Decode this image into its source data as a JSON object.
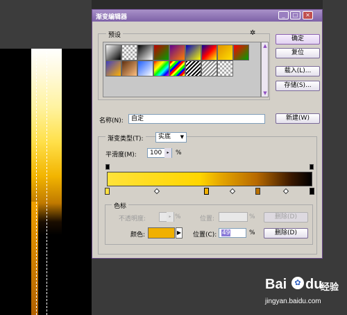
{
  "dialog": {
    "title": "渐变编辑器",
    "presets_label": "预设",
    "buttons": {
      "ok": "确定",
      "reset": "复位",
      "load": "载入(L)...",
      "save": "存储(S)...",
      "new": "新建(W)"
    },
    "name_label": "名称(N):",
    "name_value": "自定",
    "gradient_type_label": "渐变类型(T):",
    "gradient_type_value": "实底",
    "smoothness_label": "平滑度(M):",
    "smoothness_value": "100",
    "percent": "%",
    "stops_group_label": "色标",
    "opacity_label": "不透明度:",
    "position_label_disabled": "位置:",
    "delete_disabled": "删除(D)",
    "color_label": "颜色:",
    "position_label": "位置(C):",
    "position_value": "49",
    "delete_label": "删除(D)",
    "accent_color": "#f0b000"
  },
  "window_controls": [
    "minimize-icon",
    "restore-icon",
    "close-icon"
  ],
  "watermark": {
    "brand": "Bai",
    "brand2": "du",
    "sub": "经验",
    "url": "jingyan.baidu.com"
  }
}
